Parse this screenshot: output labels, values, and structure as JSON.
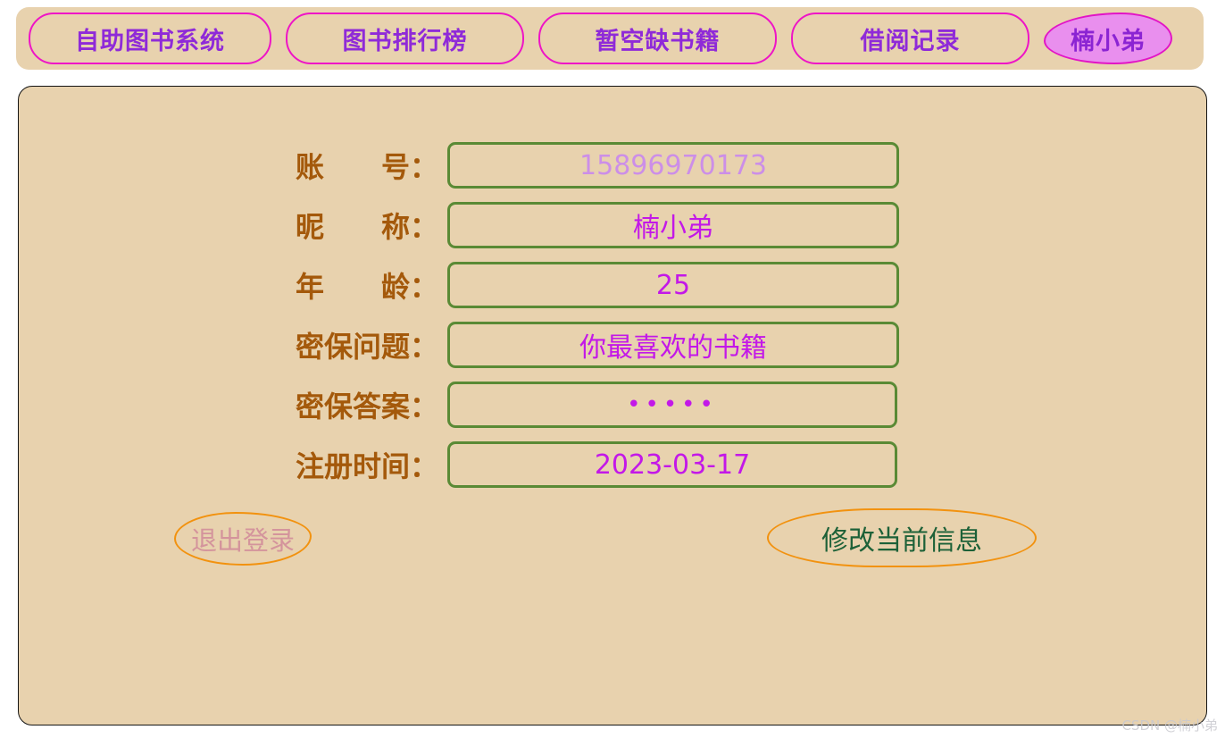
{
  "nav": {
    "tabs": [
      {
        "label": "自助图书系统",
        "active": false
      },
      {
        "label": "图书排行榜",
        "active": false
      },
      {
        "label": "暂空缺书籍",
        "active": false
      },
      {
        "label": "借阅记录",
        "active": false
      },
      {
        "label": "楠小弟",
        "active": true
      }
    ]
  },
  "colors": {
    "page_bg": "#ffffff",
    "panel_bg": "#e8d2ae",
    "tab_border": "#ee15c6",
    "tab_text": "#8f2ad8",
    "tab_active_bg": "#e98fee",
    "label_text": "#a4590b",
    "input_border": "#5a8a35",
    "input_text": "#c318e8",
    "input_text_readonly": "#cc8ee8",
    "button_border": "#f2920f",
    "logout_text": "#d4949c",
    "edit_text": "#1d6138"
  },
  "form": {
    "rows": [
      {
        "label": "账　　号：",
        "value": "15896970173",
        "readonly": true
      },
      {
        "label": "昵　　称：",
        "value": "楠小弟",
        "readonly": false
      },
      {
        "label": "年　　龄：",
        "value": "25",
        "readonly": false
      },
      {
        "label": "密保问题：",
        "value": "你最喜欢的书籍",
        "readonly": false
      },
      {
        "label": "密保答案：",
        "value": "•••••",
        "readonly": false
      },
      {
        "label": "注册时间：",
        "value": "2023-03-17",
        "readonly": false
      }
    ]
  },
  "buttons": {
    "logout": "退出登录",
    "edit": "修改当前信息"
  },
  "watermark": "CSDN @楠小弟"
}
